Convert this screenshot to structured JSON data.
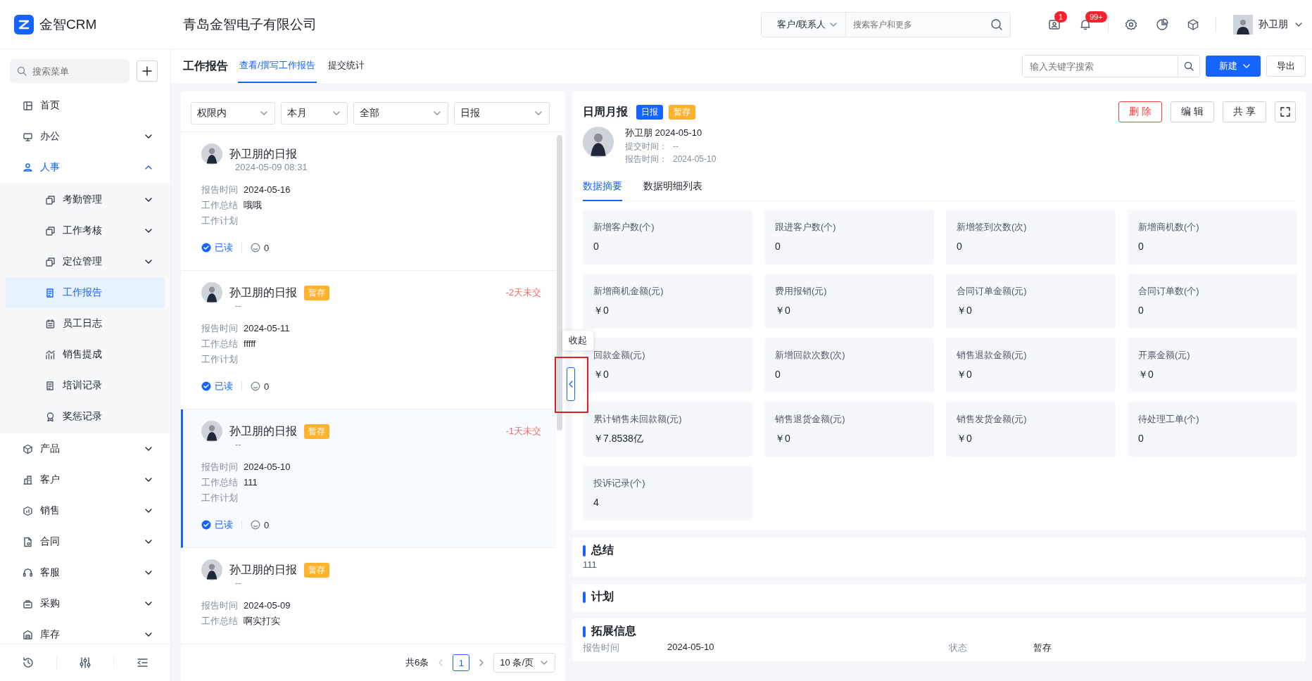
{
  "topbar": {
    "logo_text": "金智CRM",
    "company": "青岛金智电子有限公司",
    "search_scope": "客户/联系人",
    "search_placeholder": "搜索客户和更多",
    "tools": [
      {
        "kind": "contacts",
        "badge": "1"
      },
      {
        "kind": "bell",
        "badge": "99+"
      },
      {
        "kind": "gear"
      },
      {
        "kind": "pie"
      },
      {
        "kind": "cube"
      }
    ],
    "user": "孙卫朋"
  },
  "sidebar": {
    "search_placeholder": "搜索菜单",
    "items": [
      {
        "label": "首页",
        "kind": "home",
        "selected": false
      },
      {
        "label": "办公",
        "kind": "office",
        "selected": false,
        "expanded": false
      },
      {
        "label": "人事",
        "kind": "hr",
        "selected": false,
        "expanded": true,
        "children": [
          {
            "label": "考勤管理",
            "kind": "copy",
            "selected": false,
            "expanded": false
          },
          {
            "label": "工作考核",
            "kind": "copy",
            "selected": false,
            "expanded": false
          },
          {
            "label": "定位管理",
            "kind": "copy",
            "selected": false,
            "expanded": false
          },
          {
            "label": "工作报告",
            "kind": "doc",
            "selected": true
          },
          {
            "label": "员工日志",
            "kind": "calendar",
            "selected": false
          },
          {
            "label": "销售提成",
            "kind": "chart",
            "selected": false
          },
          {
            "label": "培训记录",
            "kind": "doc",
            "selected": false
          },
          {
            "label": "奖惩记录",
            "kind": "award",
            "selected": false
          }
        ]
      },
      {
        "label": "产品",
        "kind": "box",
        "selected": false,
        "expanded": false
      },
      {
        "label": "客户",
        "kind": "building",
        "selected": false,
        "expanded": false
      },
      {
        "label": "销售",
        "kind": "hex",
        "selected": false,
        "expanded": false
      },
      {
        "label": "合同",
        "kind": "file",
        "selected": false,
        "expanded": false
      },
      {
        "label": "客服",
        "kind": "headset",
        "selected": false,
        "expanded": false
      },
      {
        "label": "采购",
        "kind": "bag",
        "selected": false,
        "expanded": false
      },
      {
        "label": "库存",
        "kind": "warehouse",
        "selected": false,
        "expanded": false
      }
    ]
  },
  "page_header": {
    "title": "工作报告",
    "tabs": [
      {
        "label": "查看/撰写工作报告",
        "selected": true
      },
      {
        "label": "提交统计",
        "selected": false
      }
    ],
    "search_placeholder": "输入关键字搜索",
    "buttons": [
      {
        "label": "新建",
        "kind": "primary"
      },
      {
        "label": "导出",
        "kind": "default"
      }
    ]
  },
  "report_list": {
    "filters": [
      "权限内",
      "本月",
      "全部",
      "日报"
    ],
    "reports": [
      {
        "title": "孙卫朋的日报",
        "subtitle": "2024-05-09 08:31",
        "selected": false,
        "fields": [
          {
            "label": "报告时间",
            "value": "2024-05-16"
          },
          {
            "label": "工作总结",
            "value": "哦哦"
          },
          {
            "label": "工作计划"
          }
        ],
        "read": "已读",
        "comments": "0"
      },
      {
        "title": "孙卫朋的日报",
        "tag": "暂存",
        "overdue": "-2天未交",
        "subtitle": "--",
        "selected": false,
        "fields": [
          {
            "label": "报告时间",
            "value": "2024-05-11"
          },
          {
            "label": "工作总结",
            "value": "fffff"
          },
          {
            "label": "工作计划"
          }
        ],
        "read": "已读",
        "comments": "0"
      },
      {
        "title": "孙卫朋的日报",
        "tag": "暂存",
        "overdue": "-1天未交",
        "subtitle": "--",
        "selected": true,
        "fields": [
          {
            "label": "报告时间",
            "value": "2024-05-10"
          },
          {
            "label": "工作总结",
            "value": "111"
          },
          {
            "label": "工作计划"
          }
        ],
        "read": "已读",
        "comments": "0"
      },
      {
        "title": "孙卫朋的日报",
        "tag": "暂存",
        "subtitle": "--",
        "selected": false,
        "fields": [
          {
            "label": "报告时间",
            "value": "2024-05-09"
          },
          {
            "label": "工作总结",
            "value": "啊实打实"
          }
        ]
      }
    ],
    "pagination": {
      "total": "共6条",
      "pages": [
        {
          "label": "1",
          "selected": true
        }
      ],
      "page_size": "10 条/页"
    },
    "collapse_tooltip": "收起"
  },
  "detail": {
    "title": "日周月报",
    "tags": [
      {
        "label": "日报",
        "kind": "type"
      },
      {
        "label": "暂存",
        "kind": "status"
      }
    ],
    "actions": [
      {
        "label": "删 除",
        "kind": "danger"
      },
      {
        "label": "编 辑",
        "kind": "default"
      },
      {
        "label": "共 享",
        "kind": "default"
      }
    ],
    "author": "孙卫朋 2024-05-10",
    "meta": [
      {
        "label": "提交时间：",
        "value": "--"
      },
      {
        "label": "报告时间：",
        "value": "2024-05-10"
      }
    ],
    "tabs": [
      {
        "label": "数据摘要",
        "selected": true
      },
      {
        "label": "数据明细列表",
        "selected": false
      }
    ],
    "stats": [
      {
        "label": "新增客户数(个)",
        "value": "0"
      },
      {
        "label": "跟进客户数(个)",
        "value": "0"
      },
      {
        "label": "新增签到次数(次)",
        "value": "0"
      },
      {
        "label": "新增商机数(个)",
        "value": "0"
      },
      {
        "label": "新增商机金额(元)",
        "value": "￥0"
      },
      {
        "label": "费用报销(元)",
        "value": "￥0"
      },
      {
        "label": "合同订单金额(元)",
        "value": "￥0"
      },
      {
        "label": "合同订单数(个)",
        "value": "0"
      },
      {
        "label": "回款金额(元)",
        "value": "￥0"
      },
      {
        "label": "新增回款次数(次)",
        "value": "0"
      },
      {
        "label": "销售退款金额(元)",
        "value": "￥0"
      },
      {
        "label": "开票金额(元)",
        "value": "￥0"
      },
      {
        "label": "累计销售未回款额(元)",
        "value": "￥7.8538亿"
      },
      {
        "label": "销售退货金额(元)",
        "value": "￥0"
      },
      {
        "label": "销售发货金额(元)",
        "value": "￥0"
      },
      {
        "label": "待处理工单(个)",
        "value": "0"
      },
      {
        "label": "投诉记录(个)",
        "value": "4"
      }
    ],
    "sections": [
      {
        "title": "总结",
        "body": "111"
      },
      {
        "title": "计划"
      },
      {
        "title": "拓展信息",
        "fields": [
          {
            "label": "报告时间",
            "value": "2024-05-10"
          },
          {
            "label": "状态",
            "value": "暂存"
          }
        ]
      }
    ]
  }
}
